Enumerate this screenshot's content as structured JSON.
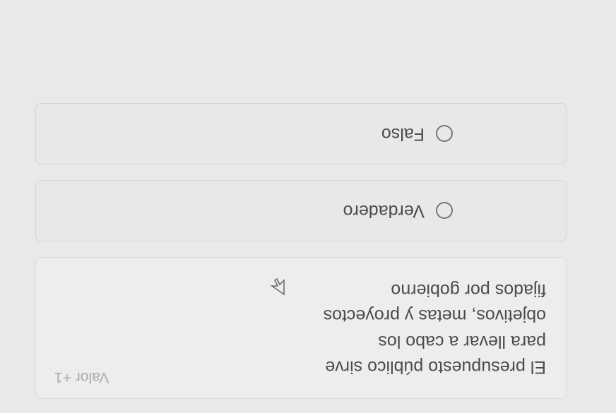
{
  "question": {
    "points_label": "Valor +1",
    "text": "El presupuesto público sirve para llevar a cabo los objetivos, metas y proyectos fijados por gobierno"
  },
  "options": [
    {
      "label": "Verdadero"
    },
    {
      "label": "Falso"
    }
  ]
}
